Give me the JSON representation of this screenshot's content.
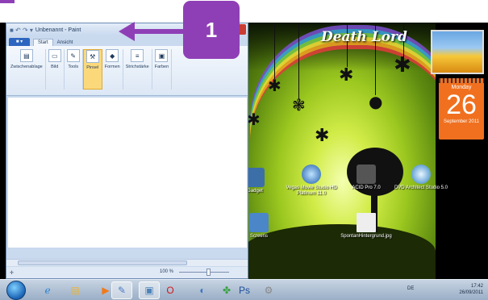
{
  "window": {
    "title": "Unbenannt - Paint",
    "quick_access": "■ ↶ ↷ ▾"
  },
  "ribbon": {
    "file_menu": "■ ▾",
    "tabs": [
      "Start",
      "Ansicht"
    ],
    "groups": [
      {
        "label": "Zwischenablage",
        "icon": "clipboard-icon",
        "glyph": "▤"
      },
      {
        "label": "Bild",
        "icon": "image-icon",
        "glyph": "▭"
      },
      {
        "label": "Tools",
        "icon": "tools-icon",
        "glyph": "✎"
      },
      {
        "label": "Pinsel",
        "icon": "brush-icon",
        "glyph": "⚒"
      },
      {
        "label": "Formen",
        "icon": "shapes-icon",
        "glyph": "◆"
      },
      {
        "label": "Strichstärke",
        "icon": "line-width-icon",
        "glyph": "≡"
      },
      {
        "label": "Farben",
        "icon": "colors-icon",
        "glyph": "▣"
      }
    ]
  },
  "status": {
    "zoom": "100 %"
  },
  "annotation": {
    "badge": "1"
  },
  "desktop": {
    "brand": "Death Lord",
    "icons": [
      {
        "label": "Gadget"
      },
      {
        "label": "Vegas Movie Studio HD Platinum 11.0"
      },
      {
        "label": "ACID Pro 7.0"
      },
      {
        "label": "DVD Architect Studio 5.0"
      },
      {
        "label": "Screens"
      },
      {
        "label": "SpontanHintergrund.jpg"
      }
    ],
    "calendar": {
      "weekday": "Monday",
      "day": "26",
      "month": "September 2011"
    }
  },
  "taskbar": {
    "items": [
      {
        "name": "internet-explorer-icon",
        "glyph": "ℯ",
        "color": "#2a83d6"
      },
      {
        "name": "explorer-folder-icon",
        "glyph": "▤",
        "color": "#e8b53a"
      },
      {
        "name": "media-player-icon",
        "glyph": "▶",
        "color": "#f07a1a"
      },
      {
        "name": "paint-taskbar-icon",
        "glyph": "✎",
        "color": "#4a7cc7"
      },
      {
        "name": "image-viewer-icon",
        "glyph": "▣",
        "color": "#4d83b9"
      },
      {
        "name": "opera-icon",
        "glyph": "O",
        "color": "#d11919"
      },
      {
        "name": "snipping-icon",
        "glyph": "◐",
        "color": "#3a74c4"
      },
      {
        "name": "clover-app-icon",
        "glyph": "✤",
        "color": "#3aa043"
      },
      {
        "name": "photoshop-icon",
        "glyph": "Ps",
        "color": "#1d4f9c"
      },
      {
        "name": "settings-app-icon",
        "glyph": "⚙",
        "color": "#888888"
      }
    ],
    "language": "DE",
    "time": "17:42",
    "date": "26/09/2011"
  }
}
